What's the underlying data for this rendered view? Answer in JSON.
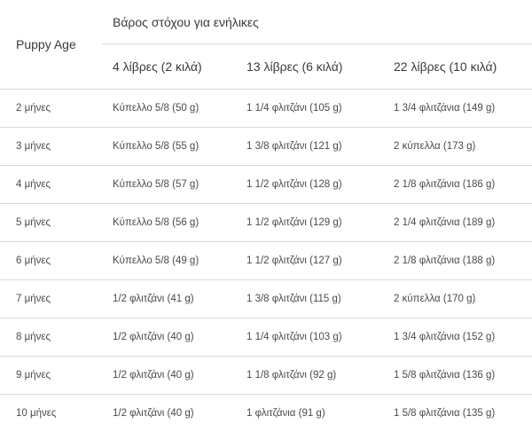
{
  "table": {
    "row_header_label": "Puppy Age",
    "group_header_label": "Βάρος στόχου για ενήλικες",
    "weight_columns": [
      "4 λίβρες (2 κιλά)",
      "13 λίβρες (6 κιλά)",
      "22 λίβρες (10 κιλά)"
    ],
    "rows": [
      {
        "age": "2 μήνες",
        "w1": "Κύπελλο 5/8 (50 g)",
        "w2": "1 1/4 φλιτζάνι (105 g)",
        "w3": "1 3/4 φλιτζάνια (149 g)"
      },
      {
        "age": "3 μήνες",
        "w1": "Κύπελλο 5/8 (55 g)",
        "w2": "1 3/8 φλιτζάνι (121 g)",
        "w3": "2 κύπελλα (173 g)"
      },
      {
        "age": "4 μήνες",
        "w1": "Κύπελλο 5/8 (57 g)",
        "w2": "1 1/2 φλιτζάνι (128 g)",
        "w3": "2 1/8 φλιτζάνια (186 g)"
      },
      {
        "age": "5 μήνες",
        "w1": "Κύπελλο 5/8 (56 g)",
        "w2": "1 1/2 φλιτζάνι (129 g)",
        "w3": "2 1/4 φλιτζάνια (189 g)"
      },
      {
        "age": "6 μήνες",
        "w1": "Κύπελλο 5/8 (49 g)",
        "w2": "1 1/2 φλιτζάνι (127 g)",
        "w3": "2 1/8 φλιτζάνια (188 g)"
      },
      {
        "age": "7 μήνες",
        "w1": "1/2 φλιτζάνι (41 g)",
        "w2": "1 3/8 φλιτζάνι (115 g)",
        "w3": "2 κύπελλα (170 g)"
      },
      {
        "age": "8 μήνες",
        "w1": "1/2 φλιτζάνι (40 g)",
        "w2": "1 1/4 φλιτζάνι (103 g)",
        "w3": "1 3/4 φλιτζάνια (152 g)"
      },
      {
        "age": "9 μήνες",
        "w1": "1/2 φλιτζάνι (40 g)",
        "w2": "1 1/8 φλιτζάνι (92 g)",
        "w3": "1 5/8 φλιτζάνια (136 g)"
      },
      {
        "age": "10 μήνες",
        "w1": "1/2 φλιτζάνι (40 g)",
        "w2": "1 φλιτζάνια (91 g)",
        "w3": "1 5/8 φλιτζάνια (135 g)"
      }
    ]
  },
  "colors": {
    "text": "#3b3b3b",
    "border": "#d9d9d9",
    "background": "#ffffff"
  }
}
